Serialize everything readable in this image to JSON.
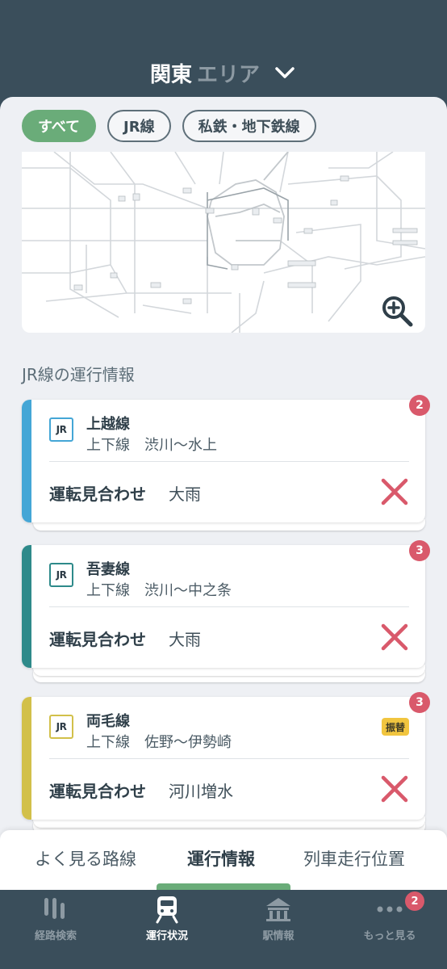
{
  "header": {
    "region_name": "関東",
    "region_suffix": "エリア",
    "dropdown_icon": "chevron-down-icon"
  },
  "filters": [
    {
      "label": "すべて",
      "active": true
    },
    {
      "label": "JR線",
      "active": false
    },
    {
      "label": "私鉄・地下鉄線",
      "active": false
    }
  ],
  "map": {
    "zoom_icon": "zoom-in-icon"
  },
  "section_title": "JR線の運行情報",
  "cards": [
    {
      "logo_text": "JR",
      "line_color": "#44a6d6",
      "line_name": "上越線",
      "direction": "上下線",
      "section": "渋川〜水上",
      "status": "運転見合わせ",
      "reason": "大雨",
      "count": "2",
      "tag": ""
    },
    {
      "logo_text": "JR",
      "line_color": "#2e8a8a",
      "line_name": "吾妻線",
      "direction": "上下線",
      "section": "渋川〜中之条",
      "status": "運転見合わせ",
      "reason": "大雨",
      "count": "3",
      "tag": ""
    },
    {
      "logo_text": "JR",
      "line_color": "#d2c04a",
      "line_name": "両毛線",
      "direction": "上下線",
      "section": "佐野〜伊勢崎",
      "status": "運転見合わせ",
      "reason": "河川増水",
      "count": "3",
      "tag": "振替"
    }
  ],
  "subtabs": [
    {
      "label": "よく見る路線",
      "active": false
    },
    {
      "label": "運行情報",
      "active": true
    },
    {
      "label": "列車走行位置",
      "active": false
    }
  ],
  "bottom_nav": [
    {
      "label": "経路検索",
      "icon": "route-search-icon",
      "active": false
    },
    {
      "label": "運行状況",
      "icon": "train-icon",
      "active": true
    },
    {
      "label": "駅情報",
      "icon": "station-icon",
      "active": false
    },
    {
      "label": "もっと見る",
      "icon": "more-icon",
      "active": false,
      "badge": "2"
    }
  ],
  "colors": {
    "accent_green": "#6aac79",
    "alert_red": "#d9596b",
    "header_bg": "#3a4e5b"
  }
}
